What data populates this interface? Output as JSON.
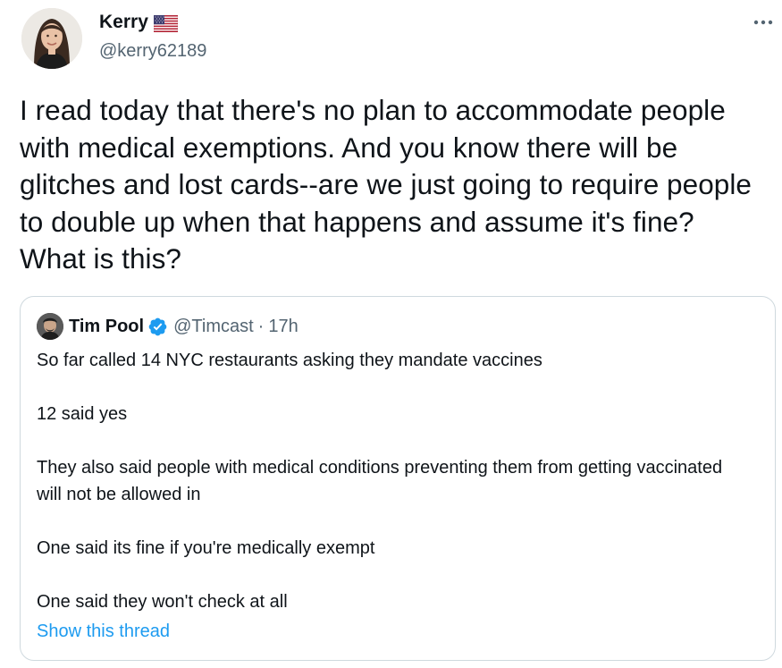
{
  "author": {
    "name": "Kerry",
    "handle": "@kerry62189",
    "flag_icon": "us-flag-icon"
  },
  "more_icon": "more-horizontal-icon",
  "tweet_text": "I read today that there's no plan to accommodate people with medical exemptions. And you know there will be glitches and lost cards--are we just going to require people to double up when that happens and assume it's fine? What is this?",
  "quoted": {
    "name": "Tim Pool",
    "verified_icon": "verified-badge-icon",
    "handle": "@Timcast",
    "separator": "·",
    "time": "17h",
    "paragraphs": [
      "So far called 14 NYC restaurants asking they mandate vaccines",
      "12 said yes",
      "They also said people with medical conditions preventing them from getting vaccinated will not be allowed in",
      "One said its fine if you're medically exempt",
      "One said they won't check at all"
    ],
    "show_thread": "Show this thread"
  },
  "colors": {
    "link_blue": "#1d9bf0",
    "secondary_text": "#536471",
    "border": "#cfd9de",
    "primary_text": "#0f1419"
  }
}
